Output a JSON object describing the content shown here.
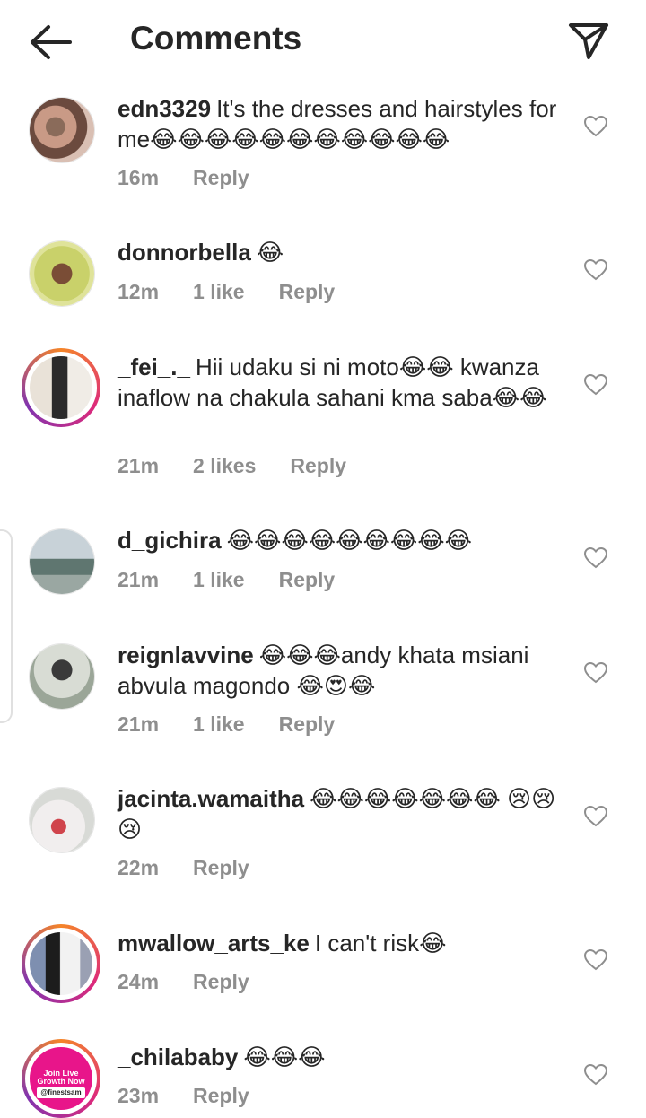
{
  "header": {
    "title": "Comments",
    "back_icon": "arrow-left-icon",
    "share_icon": "paper-plane-icon"
  },
  "colors": {
    "meta": "#8e8e8e",
    "text": "#262626",
    "ring_start": "#f58529",
    "ring_end": "#8134af"
  },
  "comments": [
    {
      "username": "edn3329",
      "text": "It's the dresses and hairstyles for me😂😂😂😂😂😂😂😂😂😂😂",
      "time": "16m",
      "likes": "",
      "reply": "Reply"
    },
    {
      "username": "donnorbella",
      "text": "😂",
      "time": "12m",
      "likes": "1 like",
      "reply": "Reply"
    },
    {
      "username": "_fei_._",
      "text": "Hii udaku si ni moto😂😂 kwanza inaflow na chakula sahani kma saba😂😂",
      "time": "21m",
      "likes": "2 likes",
      "reply": "Reply"
    },
    {
      "username": "d_gichira",
      "text": "😂😂😂😂😂😂😂😂😂",
      "time": "21m",
      "likes": "1 like",
      "reply": "Reply"
    },
    {
      "username": "reignlavvine",
      "text": "😂😂😂andy khata msiani abvula magondo 😂😍😂",
      "time": "21m",
      "likes": "1 like",
      "reply": "Reply"
    },
    {
      "username": "jacinta.wamaitha",
      "text": "😂😂😂😂😂😂😂 😢😢😢",
      "time": "22m",
      "likes": "",
      "reply": "Reply"
    },
    {
      "username": "mwallow_arts_ke",
      "text": "I can't risk😂",
      "time": "24m",
      "likes": "",
      "reply": "Reply"
    },
    {
      "username": "_chilababy",
      "text": "😂😂😂",
      "time": "23m",
      "likes": "",
      "reply": "Reply"
    }
  ],
  "promo_avatar": {
    "line1": "Join Live",
    "line2": "Growth Now",
    "handle": "@finestsam"
  }
}
